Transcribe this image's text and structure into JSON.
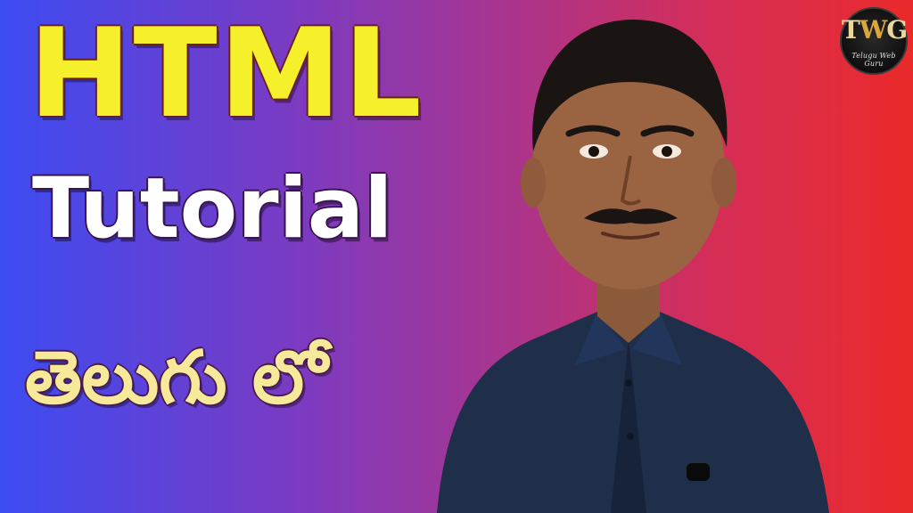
{
  "thumbnail": {
    "title": "HTML",
    "subtitle": "Tutorial",
    "telugu_line": "తెలుగు లో"
  },
  "logo": {
    "letters_left": "T",
    "letters_mid": "W",
    "letters_right": "G",
    "caption": "Telugu Web Guru"
  },
  "colors": {
    "title": "#f6ef2c",
    "subtitle": "#ffffff",
    "telugu_line": "#f6ea9a",
    "background_left": "#3d4bf2",
    "background_right": "#ea2a2a"
  }
}
